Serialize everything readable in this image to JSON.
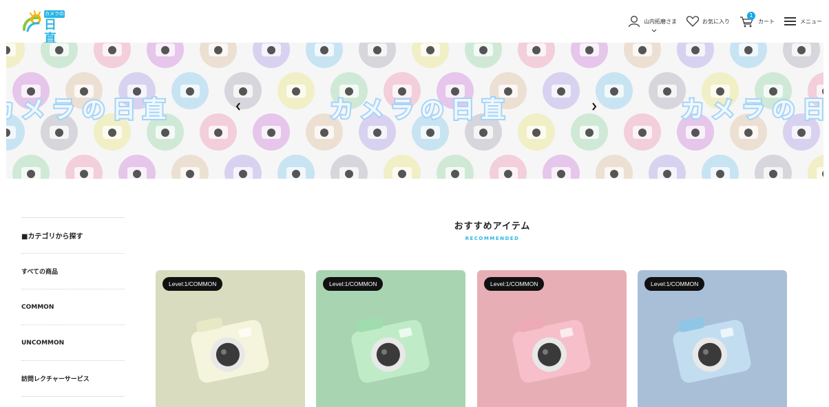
{
  "header": {
    "logo_badge": "カメラの",
    "logo_main": "日直",
    "user_label": "山内拓磨さま",
    "favorites_label": "お気に入り",
    "cart_label": "カート",
    "cart_count": "1",
    "menu_label": "メニュー"
  },
  "banner": {
    "text": "カメラの日直"
  },
  "sidebar": {
    "title": "■カテゴリから探す",
    "items": [
      {
        "label": "すべての商品"
      },
      {
        "label": "COMMON"
      },
      {
        "label": "UNCOMMON"
      },
      {
        "label": "訪問レクチャーサービス"
      }
    ]
  },
  "recommended": {
    "title": "おすすめアイテム",
    "subtitle": "RECOMMENDED",
    "cards": [
      {
        "badge": "Level:1/COMMON",
        "bg": "#d9dcbf",
        "body": "#f4f5dc",
        "accent": "#e7e9c4"
      },
      {
        "badge": "Level:1/COMMON",
        "bg": "#a9d4b1",
        "body": "#bfecc6",
        "accent": "#9fdcae"
      },
      {
        "badge": "Level:1/COMMON",
        "bg": "#e8aeb6",
        "body": "#f6bfca",
        "accent": "#eeaab7"
      },
      {
        "badge": "Level:1/COMMON",
        "bg": "#a9bfd8",
        "body": "#c3ddf0",
        "accent": "#8fc6e6"
      }
    ]
  },
  "colors": {
    "accent": "#2bb5e6",
    "badge_bg": "#111111"
  }
}
